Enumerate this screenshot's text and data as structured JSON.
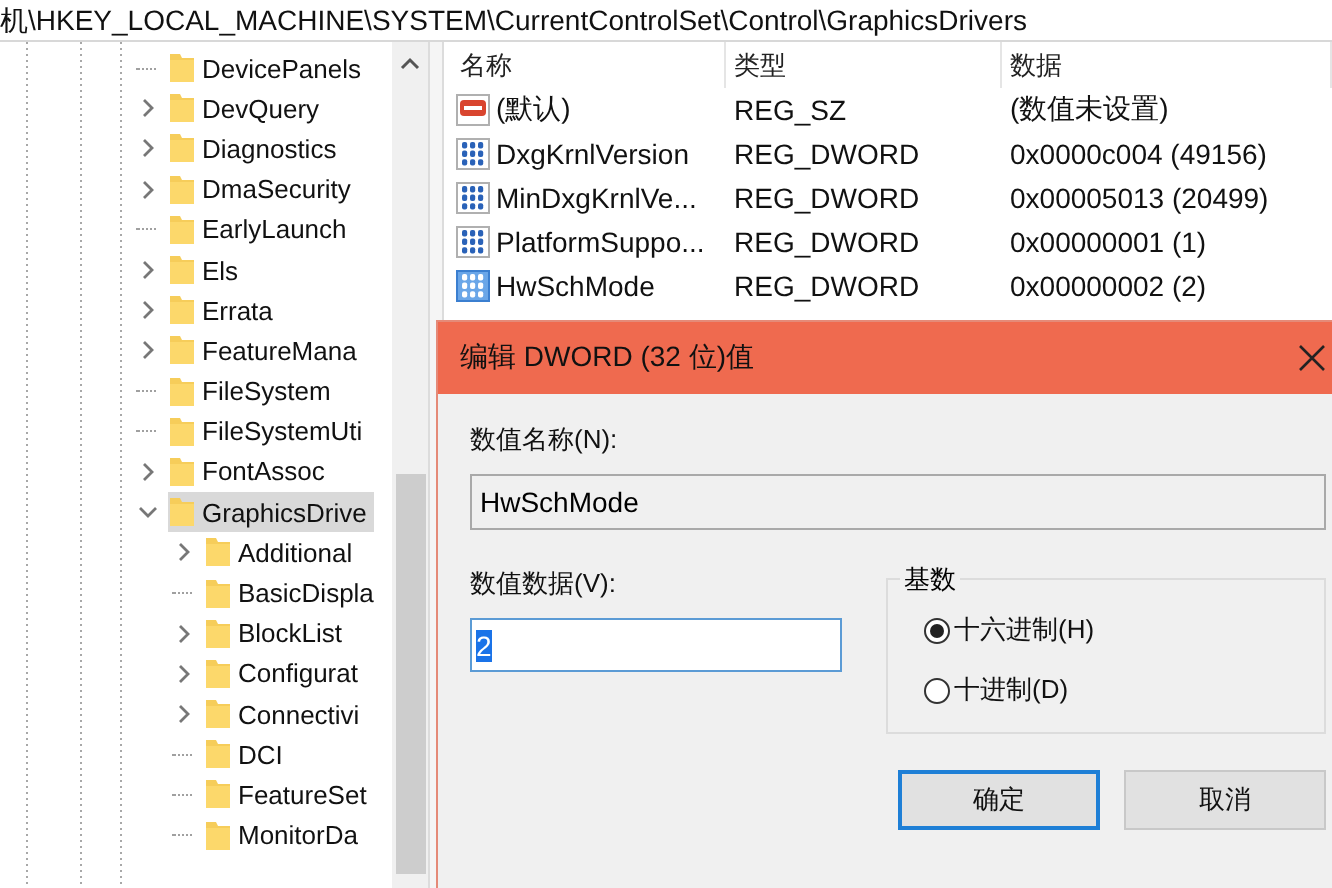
{
  "address_bar": {
    "path": "机\\HKEY_LOCAL_MACHINE\\SYSTEM\\CurrentControlSet\\Control\\GraphicsDrivers"
  },
  "tree": {
    "items": [
      {
        "label": "DevicePanels",
        "has_children": false,
        "selected": false
      },
      {
        "label": "DevQuery",
        "has_children": true,
        "expanded": false,
        "selected": false
      },
      {
        "label": "Diagnostics",
        "has_children": true,
        "expanded": false,
        "selected": false
      },
      {
        "label": "DmaSecurity",
        "has_children": true,
        "expanded": false,
        "selected": false
      },
      {
        "label": "EarlyLaunch",
        "has_children": false,
        "selected": false
      },
      {
        "label": "Els",
        "has_children": true,
        "expanded": false,
        "selected": false
      },
      {
        "label": "Errata",
        "has_children": true,
        "expanded": false,
        "selected": false
      },
      {
        "label": "FeatureMana",
        "has_children": true,
        "expanded": false,
        "selected": false
      },
      {
        "label": "FileSystem",
        "has_children": false,
        "selected": false
      },
      {
        "label": "FileSystemUti",
        "has_children": false,
        "selected": false
      },
      {
        "label": "FontAssoc",
        "has_children": true,
        "expanded": false,
        "selected": false
      },
      {
        "label": "GraphicsDrive",
        "has_children": true,
        "expanded": true,
        "selected": true,
        "children": [
          {
            "label": "Additional",
            "has_children": true,
            "expanded": false,
            "selected": false
          },
          {
            "label": "BasicDispla",
            "has_children": false,
            "selected": false
          },
          {
            "label": "BlockList",
            "has_children": true,
            "expanded": false,
            "selected": false
          },
          {
            "label": "Configurat",
            "has_children": true,
            "expanded": false,
            "selected": false
          },
          {
            "label": "Connectivi",
            "has_children": true,
            "expanded": false,
            "selected": false
          },
          {
            "label": "DCI",
            "has_children": false,
            "selected": false
          },
          {
            "label": "FeatureSet",
            "has_children": false,
            "selected": false
          },
          {
            "label": "MonitorDa",
            "has_children": false,
            "selected": false
          }
        ]
      }
    ]
  },
  "values": {
    "columns": [
      "名称",
      "类型",
      "数据"
    ],
    "rows": [
      {
        "kind": "string",
        "name": "(默认)",
        "type": "REG_SZ",
        "data": "(数值未设置)",
        "selected": false
      },
      {
        "kind": "dword",
        "name": "DxgKrnlVersion",
        "type": "REG_DWORD",
        "data": "0x0000c004 (49156)",
        "selected": false
      },
      {
        "kind": "dword",
        "name": "MinDxgKrnlVe...",
        "type": "REG_DWORD",
        "data": "0x00005013 (20499)",
        "selected": false
      },
      {
        "kind": "dword",
        "name": "PlatformSuppo...",
        "type": "REG_DWORD",
        "data": "0x00000001 (1)",
        "selected": false
      },
      {
        "kind": "dword",
        "name": "HwSchMode",
        "type": "REG_DWORD",
        "data": "0x00000002 (2)",
        "selected": true
      }
    ]
  },
  "dialog": {
    "title": "编辑 DWORD (32 位)值",
    "name_label": "数值名称(N):",
    "name_value": "HwSchMode",
    "data_label": "数值数据(V):",
    "data_value": "2",
    "data_value_selected": true,
    "base_group": {
      "title": "基数",
      "options": [
        {
          "label": "十六进制(H)",
          "selected": true
        },
        {
          "label": "十进制(D)",
          "selected": false
        }
      ]
    },
    "buttons": [
      {
        "label": "确定",
        "focused": true
      },
      {
        "label": "取消",
        "focused": false
      }
    ]
  }
}
